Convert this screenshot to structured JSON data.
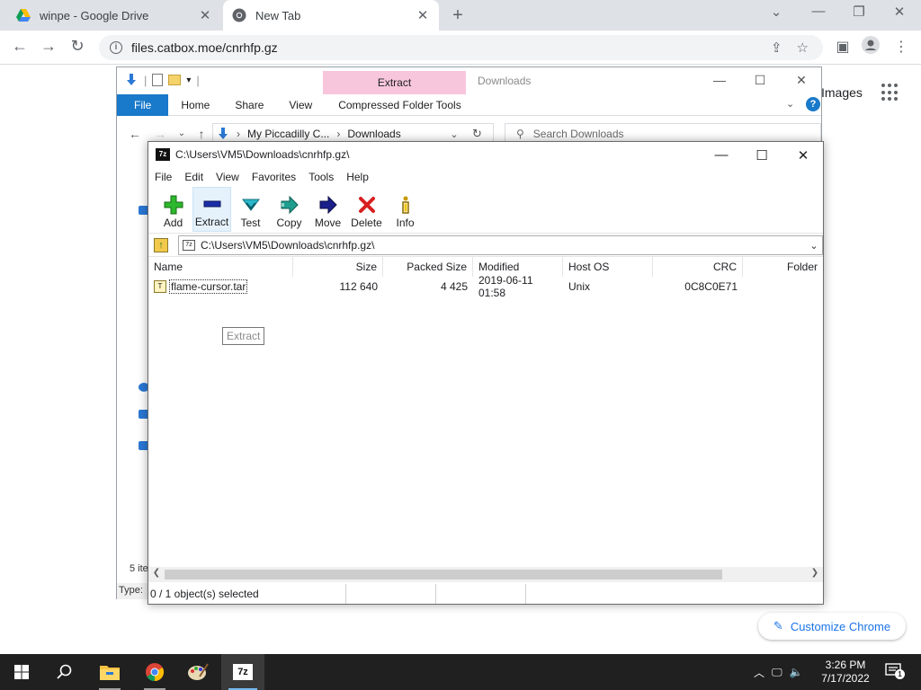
{
  "browser": {
    "tabs": [
      {
        "title": "winpe - Google Drive",
        "icon": "google-drive-icon",
        "active": false
      },
      {
        "title": "New Tab",
        "icon": "chrome-icon",
        "active": true
      }
    ],
    "url": "files.catbox.moe/cnrhfp.gz",
    "page": {
      "images_link": "Images",
      "customize_label": "Customize Chrome"
    }
  },
  "explorer": {
    "context_tab": "Extract",
    "window_title": "Downloads",
    "ribbon_tabs": [
      "File",
      "Home",
      "Share",
      "View",
      "Compressed Folder Tools"
    ],
    "breadcrumb": [
      "My Piccadilly C...",
      "Downloads"
    ],
    "search_placeholder": "Search Downloads",
    "status": "5 ite",
    "type_col": "Type:"
  },
  "sevenzip": {
    "title": "C:\\Users\\VM5\\Downloads\\cnrhfp.gz\\",
    "menu": [
      "File",
      "Edit",
      "View",
      "Favorites",
      "Tools",
      "Help"
    ],
    "toolbar": [
      {
        "label": "Add",
        "icon": "add-icon",
        "color": "#2db82d"
      },
      {
        "label": "Extract",
        "icon": "extract-icon",
        "color": "#1b2ea8"
      },
      {
        "label": "Test",
        "icon": "test-icon",
        "color": "#2ab7c9"
      },
      {
        "label": "Copy",
        "icon": "copy-icon",
        "color": "#1f9e8e"
      },
      {
        "label": "Move",
        "icon": "move-icon",
        "color": "#1b1f8a"
      },
      {
        "label": "Delete",
        "icon": "delete-icon",
        "color": "#d81f1f"
      },
      {
        "label": "Info",
        "icon": "info-icon",
        "color": "#c79a00"
      }
    ],
    "path": "C:\\Users\\VM5\\Downloads\\cnrhfp.gz\\",
    "tooltip": "Extract",
    "columns": [
      "Name",
      "Size",
      "Packed Size",
      "Modified",
      "Host OS",
      "CRC",
      "Folder"
    ],
    "rows": [
      {
        "name": "flame-cursor.tar",
        "size": "112 640",
        "packed": "4 425",
        "modified": "2019-06-11 01:58",
        "host": "Unix",
        "crc": "0C8C0E71"
      }
    ],
    "status": "0 / 1 object(s) selected"
  },
  "taskbar": {
    "time": "3:26 PM",
    "date": "7/17/2022",
    "notification_count": "1"
  }
}
